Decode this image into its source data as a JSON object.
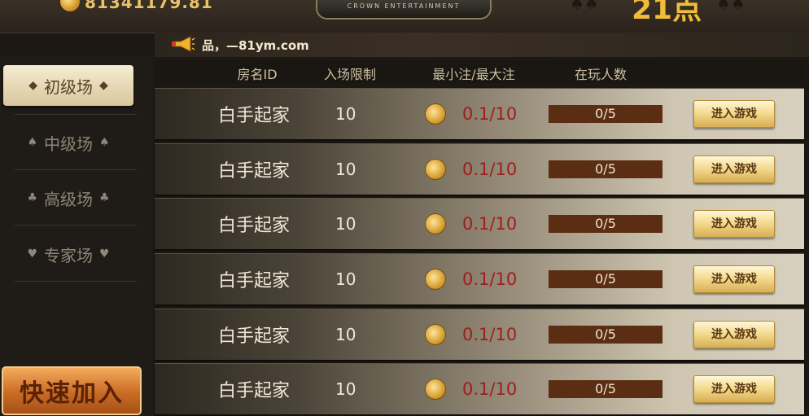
{
  "header": {
    "balance": "81341179.81",
    "logo_text": "CROWN ENTERTAINMENT",
    "big_number": "21点"
  },
  "notice": {
    "text": "品，—81ym.com"
  },
  "sidebar": {
    "items": [
      {
        "label": "初级场",
        "suit": "◆",
        "active": true
      },
      {
        "label": "中级场",
        "suit": "♠",
        "active": false
      },
      {
        "label": "高级场",
        "suit": "♣",
        "active": false
      },
      {
        "label": "专家场",
        "suit": "♥",
        "active": false
      }
    ],
    "quick_join": "快速加入"
  },
  "table": {
    "headers": [
      "房名ID",
      "入场限制",
      "最小注/最大注",
      "在玩人数"
    ],
    "rows": [
      {
        "room": "白手起家",
        "limit": "10",
        "bet": "0.1/10",
        "players": "0/5",
        "action": "进入游戏"
      },
      {
        "room": "白手起家",
        "limit": "10",
        "bet": "0.1/10",
        "players": "0/5",
        "action": "进入游戏"
      },
      {
        "room": "白手起家",
        "limit": "10",
        "bet": "0.1/10",
        "players": "0/5",
        "action": "进入游戏"
      },
      {
        "room": "白手起家",
        "limit": "10",
        "bet": "0.1/10",
        "players": "0/5",
        "action": "进入游戏"
      },
      {
        "room": "白手起家",
        "limit": "10",
        "bet": "0.1/10",
        "players": "0/5",
        "action": "进入游戏"
      },
      {
        "room": "白手起家",
        "limit": "10",
        "bet": "0.1/10",
        "players": "0/5",
        "action": "进入游戏"
      }
    ]
  },
  "colors": {
    "gold": "#f0bd3a",
    "bet_red": "#a01e1e",
    "players_bar": "#5b2d12"
  }
}
